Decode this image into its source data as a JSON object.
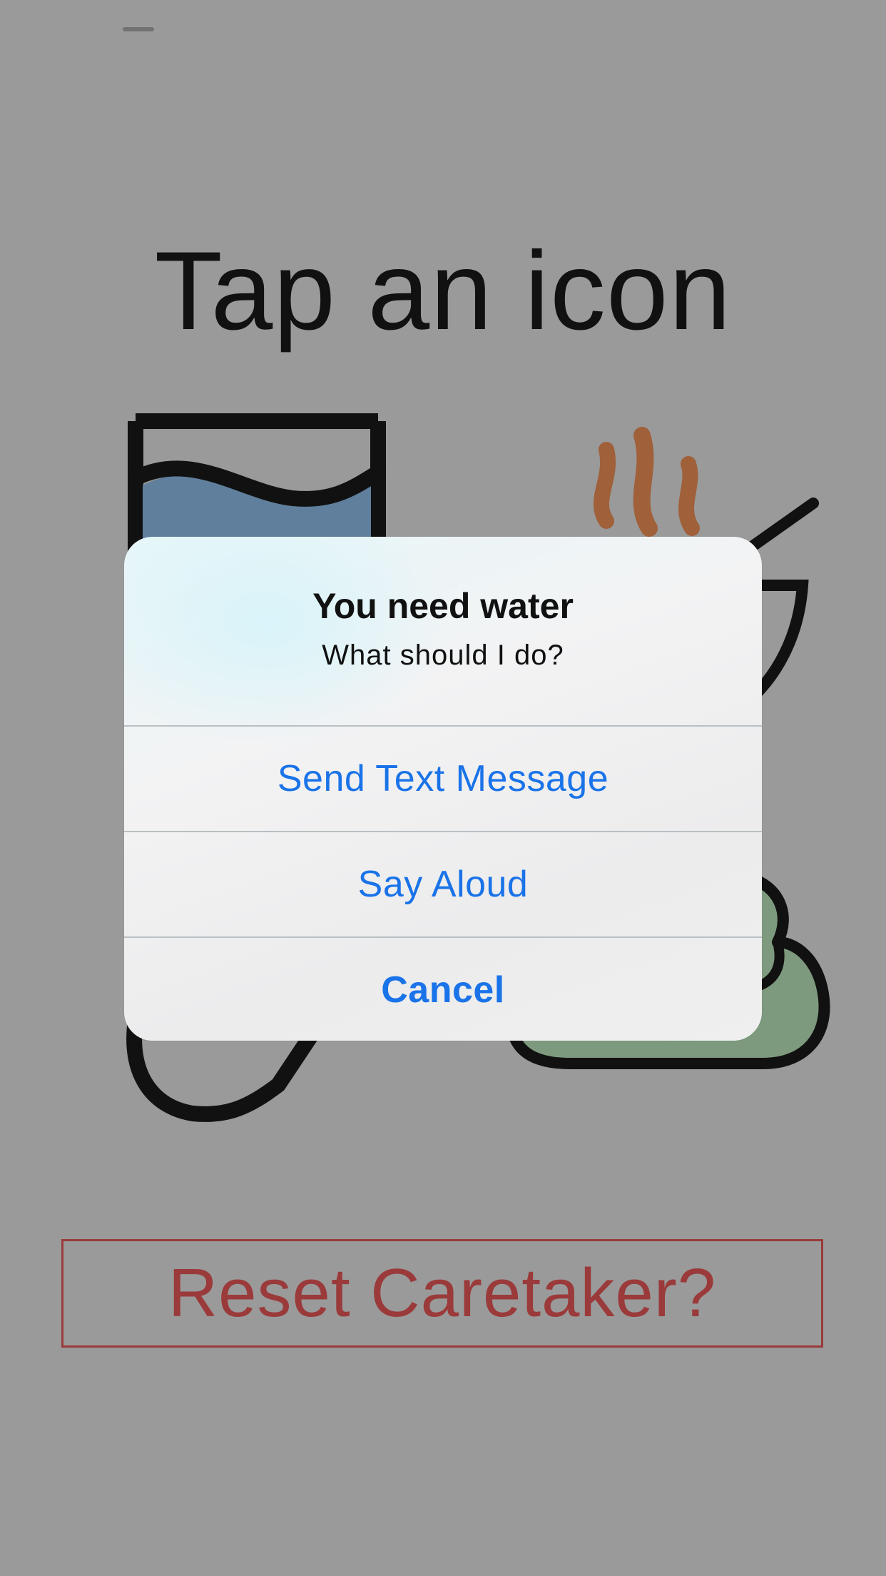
{
  "screen": {
    "title": "Tap an icon",
    "background_color": "#9a9a9a"
  },
  "icons": [
    {
      "name": "water-glass-icon"
    },
    {
      "name": "hot-food-bowl-icon"
    },
    {
      "name": "bath-brush-icon"
    },
    {
      "name": "soap-towel-icon"
    }
  ],
  "reset": {
    "label": "Reset Caretaker?",
    "color": "#9b3a3a"
  },
  "alert": {
    "title": "You need water",
    "message": "What should I do?",
    "actions": [
      {
        "label": "Send Text Message",
        "style": "default"
      },
      {
        "label": "Say Aloud",
        "style": "default"
      },
      {
        "label": "Cancel",
        "style": "cancel"
      }
    ],
    "accent_color": "#1a73e8"
  }
}
